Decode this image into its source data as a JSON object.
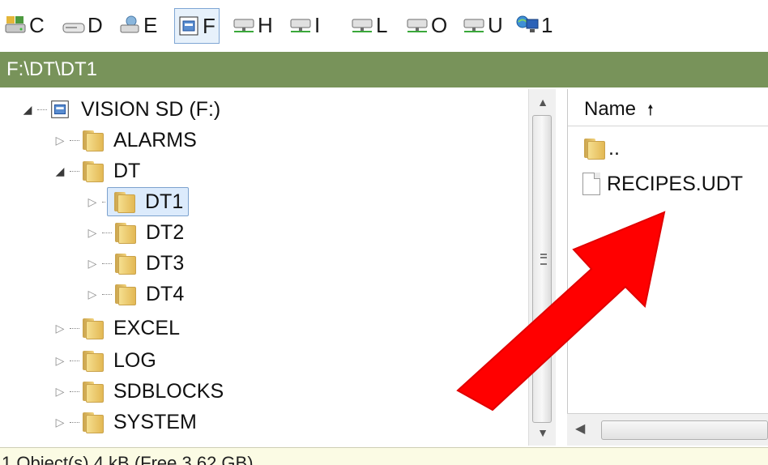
{
  "drives": [
    {
      "letter": "C",
      "icon": "system-drive-icon"
    },
    {
      "letter": "D",
      "icon": "hard-drive-icon"
    },
    {
      "letter": "E",
      "icon": "network-drive-icon"
    },
    {
      "letter": "F",
      "icon": "sd-card-drive-icon",
      "selected": true
    },
    {
      "letter": "H",
      "icon": "network-drive-icon"
    },
    {
      "letter": "I",
      "icon": "network-drive-icon"
    },
    {
      "letter": "L",
      "icon": "network-drive-icon"
    },
    {
      "letter": "O",
      "icon": "network-drive-icon"
    },
    {
      "letter": "U",
      "icon": "network-drive-icon"
    },
    {
      "letter": "1",
      "icon": "network-computer-icon"
    }
  ],
  "path": "F:\\DT\\DT1",
  "tree": {
    "root": "VISION SD (F:)",
    "items": [
      {
        "label": "ALARMS"
      },
      {
        "label": "DT"
      },
      {
        "label": "DT1"
      },
      {
        "label": "DT2"
      },
      {
        "label": "DT3"
      },
      {
        "label": "DT4"
      },
      {
        "label": "EXCEL"
      },
      {
        "label": "LOG"
      },
      {
        "label": "SDBLOCKS"
      },
      {
        "label": "SYSTEM"
      }
    ]
  },
  "list": {
    "column_name": "Name",
    "sort_icon": "sort-ascending-icon",
    "items": [
      {
        "label": ".."
      },
      {
        "label": "RECIPES.UDT"
      }
    ]
  },
  "status": "1 Object(s)   4 kB     (Free 3.62 GB)",
  "colors": {
    "pathbar": "#78935a",
    "annotation_arrow": "#ff0000",
    "selection": "#dcebfc"
  }
}
